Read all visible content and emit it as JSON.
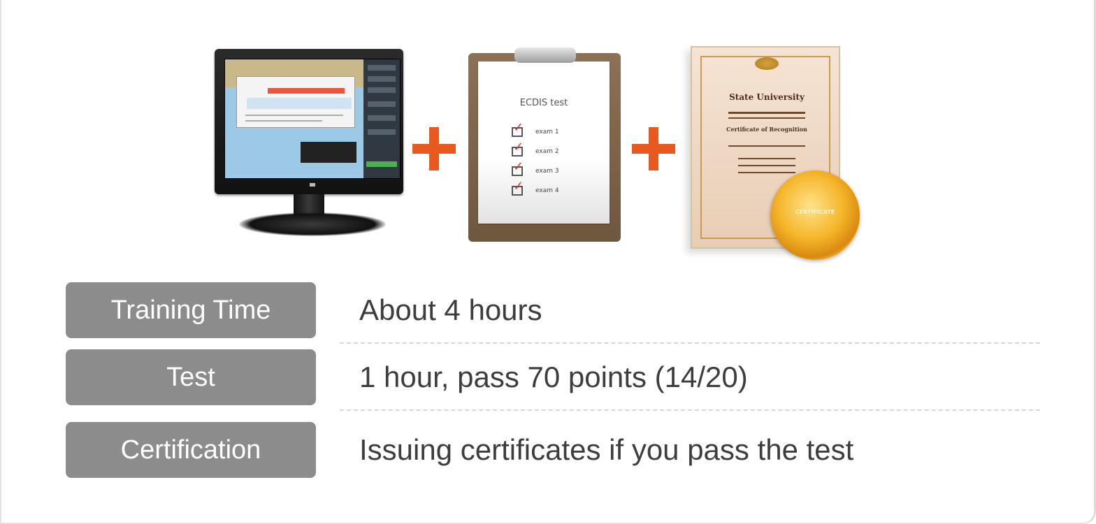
{
  "illustrations": {
    "clipboard": {
      "title": "ECDIS test",
      "items": [
        "exam 1",
        "exam 2",
        "exam 3",
        "exam 4"
      ]
    },
    "certificate": {
      "heading": "State University",
      "subtitle": "Certificate of Recognition",
      "seal_text": "CERTIFICATE"
    }
  },
  "rows": [
    {
      "label": "Training Time",
      "value": "About 4 hours"
    },
    {
      "label": "Test",
      "value": "1 hour, pass 70 points (14/20)"
    },
    {
      "label": "Certification",
      "value": "Issuing certificates if you pass the test"
    }
  ],
  "colors": {
    "accent_plus": "#e8591f",
    "label_bg": "#8c8c8c",
    "label_text": "#ffffff",
    "value_text": "#3d3d3d",
    "divider": "#d6d6d6"
  }
}
